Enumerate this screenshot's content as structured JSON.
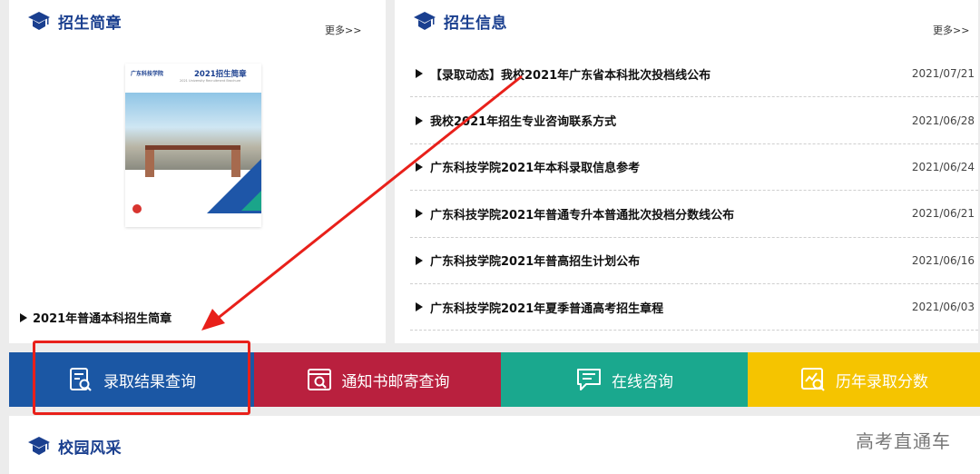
{
  "colors": {
    "accent_blue": "#1a3f8f",
    "btn_blue": "#1b57a4",
    "btn_red": "#b9203e",
    "btn_green": "#1aa88e",
    "btn_yellow": "#f5c400",
    "annotation_red": "#e8201a"
  },
  "brochure_section": {
    "title": "招生简章",
    "more": "更多>>",
    "icon": "graduation-cap-icon",
    "cover": {
      "logo_text": "广东科技学院",
      "title": "2021招生简章",
      "subtitle": "2021 University Recruitment Brochure"
    },
    "link": "2021年普通本科招生简章"
  },
  "news_section": {
    "title": "招生信息",
    "more": "更多>>",
    "icon": "graduation-cap-icon",
    "items": [
      {
        "title": "【录取动态】我校2021年广东省本科批次投档线公布",
        "date": "2021/07/21"
      },
      {
        "title": "我校2021年招生专业咨询联系方式",
        "date": "2021/06/28"
      },
      {
        "title": "广东科技学院2021年本科录取信息参考",
        "date": "2021/06/24"
      },
      {
        "title": "广东科技学院2021年普通专升本普通批次投档分数线公布",
        "date": "2021/06/21"
      },
      {
        "title": "广东科技学院2021年普高招生计划公布",
        "date": "2021/06/16"
      },
      {
        "title": "广东科技学院2021年夏季普通高考招生章程",
        "date": "2021/06/03"
      }
    ]
  },
  "quick_buttons": [
    {
      "label": "录取结果查询",
      "icon": "search-document-icon"
    },
    {
      "label": "通知书邮寄查询",
      "icon": "browser-search-icon"
    },
    {
      "label": "在线咨询",
      "icon": "chat-bubble-icon"
    },
    {
      "label": "历年录取分数",
      "icon": "chart-search-icon"
    }
  ],
  "campus_section": {
    "title": "校园风采",
    "icon": "graduation-cap-icon"
  },
  "watermark": "高考直通车"
}
